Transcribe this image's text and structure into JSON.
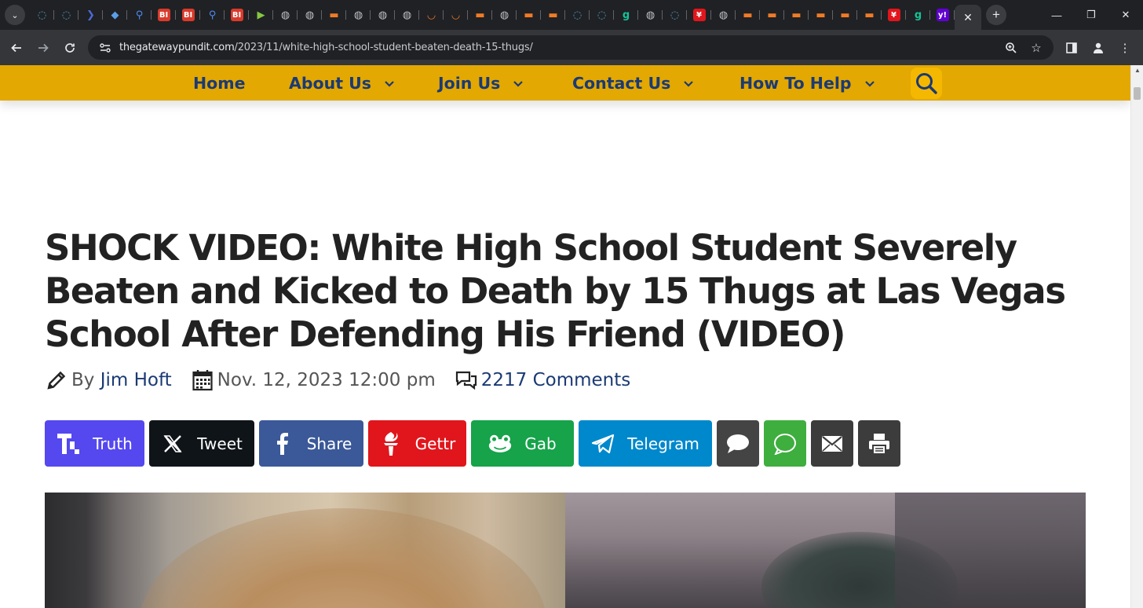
{
  "browser": {
    "active_tab_close": "✕",
    "new_tab": "+",
    "url_host": "thegatewaypundit.com",
    "url_path": "/2023/11/white-high-school-student-beaten-death-15-thugs/",
    "pinned_tabs": [
      {
        "icon": "shield-icon",
        "color": "#4fa3d1",
        "glyph": "◌"
      },
      {
        "icon": "shield-icon",
        "color": "#4fa3d1",
        "glyph": "◌"
      },
      {
        "icon": "chevron-icon",
        "color": "#4b6bd6",
        "glyph": "❯"
      },
      {
        "icon": "diamond-icon",
        "color": "#5a9ee8",
        "glyph": "◆"
      },
      {
        "icon": "search-icon",
        "color": "#4d8af0",
        "glyph": "⚲"
      },
      {
        "icon": "business-insider-icon",
        "color": "#d93a2b",
        "glyph": "BI"
      },
      {
        "icon": "business-insider-icon",
        "color": "#d93a2b",
        "glyph": "BI"
      },
      {
        "icon": "search-icon",
        "color": "#4d8af0",
        "glyph": "⚲"
      },
      {
        "icon": "business-insider-icon",
        "color": "#d93a2b",
        "glyph": "BI"
      },
      {
        "icon": "rumble-icon",
        "color": "#85c742",
        "glyph": "▶"
      },
      {
        "icon": "globe-icon",
        "color": "#bdc1c6",
        "glyph": "◍"
      },
      {
        "icon": "globe-icon",
        "color": "#bdc1c6",
        "glyph": "◍"
      },
      {
        "icon": "bookmark-icon",
        "color": "#f07b26",
        "glyph": "▬"
      },
      {
        "icon": "globe-icon",
        "color": "#bdc1c6",
        "glyph": "◍"
      },
      {
        "icon": "globe-icon",
        "color": "#bdc1c6",
        "glyph": "◍"
      },
      {
        "icon": "globe-icon",
        "color": "#bdc1c6",
        "glyph": "◍"
      },
      {
        "icon": "shield-outline-icon",
        "color": "#f07b26",
        "glyph": "◡"
      },
      {
        "icon": "shield-outline-icon",
        "color": "#f07b26",
        "glyph": "◡"
      },
      {
        "icon": "bookmark-icon",
        "color": "#f07b26",
        "glyph": "▬"
      },
      {
        "icon": "globe-icon",
        "color": "#bdc1c6",
        "glyph": "◍"
      },
      {
        "icon": "bookmark-icon",
        "color": "#f07b26",
        "glyph": "▬"
      },
      {
        "icon": "bookmark-icon",
        "color": "#f07b26",
        "glyph": "▬"
      },
      {
        "icon": "shield-icon",
        "color": "#4fa3d1",
        "glyph": "◌"
      },
      {
        "icon": "shield-icon",
        "color": "#4fa3d1",
        "glyph": "◌"
      },
      {
        "icon": "g-icon",
        "color": "#15c39a",
        "glyph": "g"
      },
      {
        "icon": "globe-icon",
        "color": "#bdc1c6",
        "glyph": "◍"
      },
      {
        "icon": "shield-icon",
        "color": "#4fa3d1",
        "glyph": "◌"
      },
      {
        "icon": "gettr-icon",
        "color": "#e0161c",
        "glyph": "¥"
      },
      {
        "icon": "globe-icon",
        "color": "#bdc1c6",
        "glyph": "◍"
      },
      {
        "icon": "bookmark-icon",
        "color": "#f07b26",
        "glyph": "▬"
      },
      {
        "icon": "bookmark-icon",
        "color": "#f07b26",
        "glyph": "▬"
      },
      {
        "icon": "bookmark-icon",
        "color": "#f07b26",
        "glyph": "▬"
      },
      {
        "icon": "bookmark-icon",
        "color": "#f07b26",
        "glyph": "▬"
      },
      {
        "icon": "bookmark-icon",
        "color": "#f07b26",
        "glyph": "▬"
      },
      {
        "icon": "bookmark-icon",
        "color": "#f07b26",
        "glyph": "▬"
      },
      {
        "icon": "gettr-icon",
        "color": "#e0161c",
        "glyph": "¥"
      },
      {
        "icon": "g-icon",
        "color": "#15c39a",
        "glyph": "g"
      },
      {
        "icon": "yahoo-icon",
        "color": "#6001d2",
        "glyph": "y!"
      }
    ]
  },
  "site_nav": {
    "items": [
      {
        "label": "Home",
        "dropdown": false
      },
      {
        "label": "About Us",
        "dropdown": true
      },
      {
        "label": "Join Us",
        "dropdown": true
      },
      {
        "label": "Contact Us",
        "dropdown": true
      },
      {
        "label": "How To Help",
        "dropdown": true
      }
    ],
    "search_icon": "search-icon",
    "bar_color": "#e3a802",
    "text_color": "#1b3a74"
  },
  "article": {
    "title": "SHOCK VIDEO: White High School Student Severely Beaten and Kicked to Death by 15 Thugs at Las Vegas School After Defending His Friend (VIDEO)",
    "by_label": "By",
    "author": "Jim Hoft",
    "date": "Nov. 12, 2023 12:00 pm",
    "comments": "2217 Comments"
  },
  "share_buttons": [
    {
      "label": "Truth",
      "color": "#5448ee",
      "icon": "truth-social-icon"
    },
    {
      "label": "Tweet",
      "color": "#0f1419",
      "icon": "x-icon"
    },
    {
      "label": "Share",
      "color": "#3b5998",
      "icon": "facebook-icon"
    },
    {
      "label": "Gettr",
      "color": "#e0161c",
      "icon": "gettr-icon"
    },
    {
      "label": "Gab",
      "color": "#16a34a",
      "icon": "gab-frog-icon"
    },
    {
      "label": "Telegram",
      "color": "#0088cc",
      "icon": "telegram-icon"
    },
    {
      "label": "",
      "color": "#444444",
      "icon": "speech-bubble-icon"
    },
    {
      "label": "",
      "color": "#3eae3e",
      "icon": "sms-icon"
    },
    {
      "label": "",
      "color": "#3c3c3c",
      "icon": "email-icon"
    },
    {
      "label": "",
      "color": "#3c3c3c",
      "icon": "print-icon"
    }
  ]
}
